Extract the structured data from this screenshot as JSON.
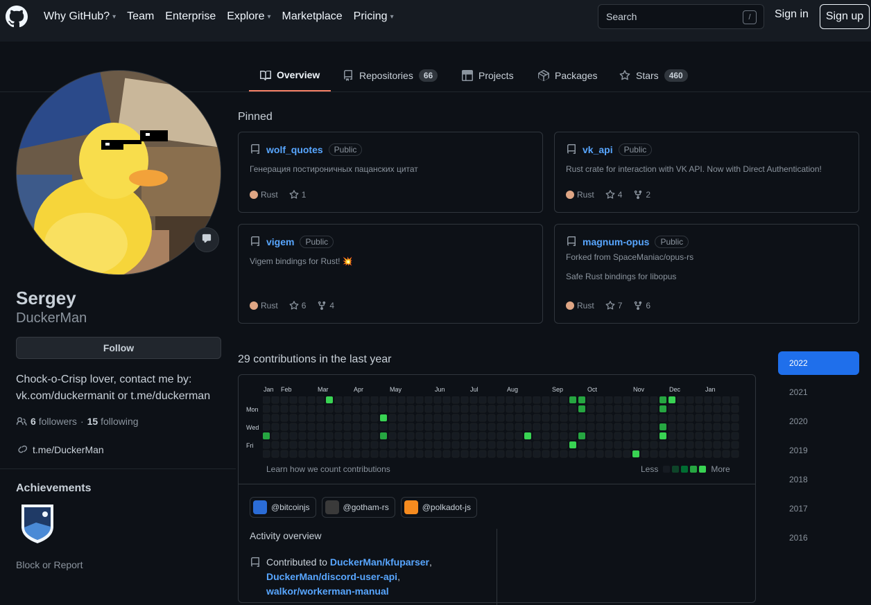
{
  "header": {
    "nav": [
      {
        "label": "Why GitHub?",
        "dropdown": true
      },
      {
        "label": "Team",
        "dropdown": false
      },
      {
        "label": "Enterprise",
        "dropdown": false
      },
      {
        "label": "Explore",
        "dropdown": true
      },
      {
        "label": "Marketplace",
        "dropdown": false
      },
      {
        "label": "Pricing",
        "dropdown": true
      }
    ],
    "search_placeholder": "Search",
    "search_shortcut": "/",
    "signin": "Sign in",
    "signup": "Sign up"
  },
  "tabs": [
    {
      "label": "Overview",
      "count": ""
    },
    {
      "label": "Repositories",
      "count": "66"
    },
    {
      "label": "Projects",
      "count": ""
    },
    {
      "label": "Packages",
      "count": ""
    },
    {
      "label": "Stars",
      "count": "460"
    }
  ],
  "profile": {
    "name": "Sergey",
    "login": "DuckerMan",
    "follow": "Follow",
    "bio": "Chock-o-Crisp lover, contact me by: vk.com/duckermanit or t.me/duckerman",
    "followers_count": "6",
    "followers_label": "followers",
    "sep": "·",
    "following_count": "15",
    "following_label": "following",
    "link": "t.me/DuckerMan",
    "achievements": "Achievements",
    "block": "Block or Report"
  },
  "pinned": {
    "title": "Pinned",
    "repos": [
      {
        "name": "wolf_quotes",
        "visibility": "Public",
        "fork": "",
        "desc": "Генерация постироничных пацанских цитат",
        "lang": "Rust",
        "stars": "1",
        "forks": ""
      },
      {
        "name": "vk_api",
        "visibility": "Public",
        "fork": "",
        "desc": "Rust crate for interaction with VK API. Now with Direct Authentication!",
        "lang": "Rust",
        "stars": "4",
        "forks": "2"
      },
      {
        "name": "vigem",
        "visibility": "Public",
        "fork": "",
        "desc": "Vigem bindings for Rust! 💥",
        "lang": "Rust",
        "stars": "6",
        "forks": "4"
      },
      {
        "name": "magnum-opus",
        "visibility": "Public",
        "fork": "Forked from SpaceManiac/opus-rs",
        "desc": "Safe Rust bindings for libopus",
        "lang": "Rust",
        "stars": "7",
        "forks": "6"
      }
    ]
  },
  "contributions": {
    "title": "29 contributions in the last year",
    "months": [
      "Jan",
      "Feb",
      "Mar",
      "Apr",
      "May",
      "Jun",
      "Jul",
      "Aug",
      "Sep",
      "Oct",
      "Nov",
      "Dec",
      "Jan"
    ],
    "days": [
      "Mon",
      "Wed",
      "Fri"
    ],
    "learn": "Learn how we count contributions",
    "less": "Less",
    "more": "More",
    "colors": [
      "#161b22",
      "#0e4429",
      "#006d32",
      "#26a641",
      "#39d353"
    ]
  },
  "orgs": [
    {
      "name": "@bitcoinjs",
      "color": "#2b6cd6"
    },
    {
      "name": "@gotham-rs",
      "color": "#3a3a3a"
    },
    {
      "name": "@polkadot-js",
      "color": "#f68b1f"
    }
  ],
  "activity": {
    "title": "Activity overview",
    "prefix": "Contributed to",
    "repos": [
      "DuckerMan/kfuparser",
      "DuckerMan/discord-user-api",
      "walkor/workerman-manual"
    ]
  },
  "years": [
    "2022",
    "2021",
    "2020",
    "2019",
    "2018",
    "2017",
    "2016"
  ]
}
